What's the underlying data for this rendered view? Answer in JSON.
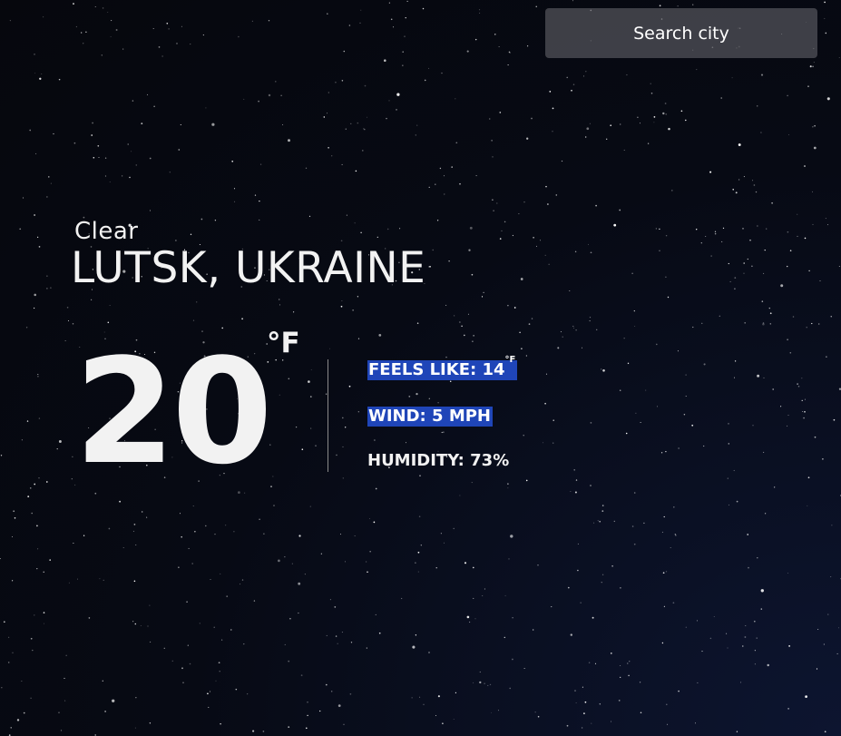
{
  "search": {
    "placeholder": "Search city"
  },
  "weather": {
    "condition": "Clear",
    "location": "LUTSK, UKRAINE",
    "temperature": "20",
    "unit": "°F",
    "feels_like_label": "FEELS LIKE: 14",
    "feels_like_unit": "°F",
    "wind_label": "WIND: 5 MPH",
    "humidity_label": "HUMIDITY: 73%"
  },
  "colors": {
    "background": "#06070d",
    "text": "#f2f2f2",
    "search_bg": "#55555c",
    "highlight": "#1f45b8"
  }
}
